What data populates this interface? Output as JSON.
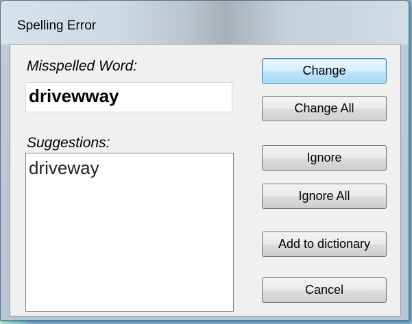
{
  "window": {
    "title": "Spelling Error"
  },
  "misspelled": {
    "label": "Misspelled Word:",
    "word": "drivewway"
  },
  "suggestions": {
    "label": "Suggestions:",
    "items": [
      "driveway"
    ]
  },
  "buttons": {
    "change": "Change",
    "change_all": "Change All",
    "ignore": "Ignore",
    "ignore_all": "Ignore All",
    "add_to_dictionary": "Add to dictionary",
    "cancel": "Cancel"
  },
  "colors": {
    "desktop": "#7fb6d4",
    "dialog_face": "#f0f0f0",
    "default_button_border": "#3c7fb1"
  }
}
